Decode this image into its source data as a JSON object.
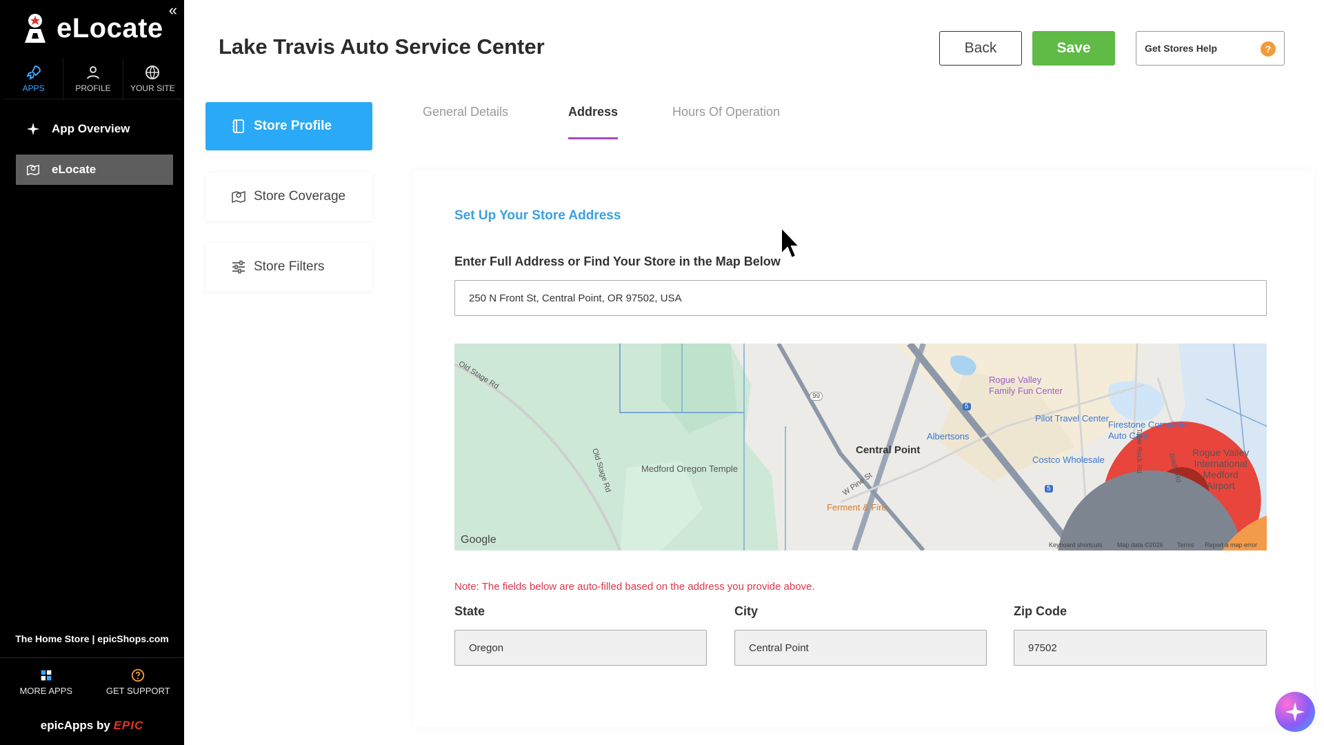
{
  "app": {
    "name": "eLocate",
    "store_name": "The Home Store | epicShops.com",
    "powered_prefix": "epicApps by",
    "powered_brand": "EPIC"
  },
  "sidebar": {
    "tabs": [
      {
        "label": "APPS",
        "icon": "rocket-icon",
        "active": true
      },
      {
        "label": "PROFILE",
        "icon": "user-icon"
      },
      {
        "label": "YOUR SITE",
        "icon": "globe-icon"
      }
    ],
    "items": [
      {
        "label": "App Overview",
        "icon": "sparkle-icon"
      },
      {
        "label": "eLocate",
        "icon": "map-pin-icon",
        "active": true
      }
    ],
    "bottom": [
      {
        "label": "MORE APPS",
        "icon": "grid-icon"
      },
      {
        "label": "GET SUPPORT",
        "icon": "help-icon"
      }
    ]
  },
  "header": {
    "title": "Lake Travis Auto Service Center",
    "back_label": "Back",
    "save_label": "Save",
    "help_label": "Get Stores Help",
    "help_glyph": "?"
  },
  "left_menu": [
    {
      "label": "Store Profile",
      "active": true
    },
    {
      "label": "Store Coverage"
    },
    {
      "label": "Store Filters"
    }
  ],
  "tabs": [
    {
      "label": "General Details"
    },
    {
      "label": "Address",
      "active": true
    },
    {
      "label": "Hours Of Operation"
    }
  ],
  "form": {
    "section_title": "Set Up Your Store Address",
    "address_label": "Enter Full Address or Find Your Store in the Map Below",
    "address_value": "250 N Front St, Central Point, OR 97502, USA",
    "note": "Note: The fields below are auto-filled based on the address you provide above.",
    "state_label": "State",
    "state_value": "Oregon",
    "city_label": "City",
    "city_value": "Central Point",
    "zip_label": "Zip Code",
    "zip_value": "97502"
  },
  "map": {
    "labels": {
      "central_point": "Central Point",
      "temple": "Medford Oregon Temple",
      "old_stage_1": "Old Stage Rd",
      "old_stage_2": "Old Stage Rd",
      "rogue_fun_1": "Rogue Valley",
      "rogue_fun_2": "Family Fun Center",
      "pilot": "Pilot Travel Center",
      "firestone_1": "Firestone Complete",
      "firestone_2": "Auto Care",
      "albertsons": "Albertsons",
      "costco": "Costco Wholesale",
      "airport": "Rogue Valley\nInternational\nMedford\nAirport",
      "ferment": "Ferment & Fire",
      "pine": "W Pine St",
      "table_rock": "Table Rock Rd",
      "biddle": "Biddle Rd",
      "route_99": "99",
      "route_5a": "5",
      "route_5b": "5"
    },
    "google": "Google",
    "attrib_keyboard": "Keyboard shortcuts",
    "attrib_data": "Map data ©2026",
    "attrib_terms": "Terms",
    "attrib_report": "Report a map error"
  },
  "colors": {
    "primary": "#2aa9f7",
    "save": "#5fba46",
    "tab_underline": "#a04bc3",
    "note": "#d9364d",
    "help_badge": "#f39b3a"
  }
}
